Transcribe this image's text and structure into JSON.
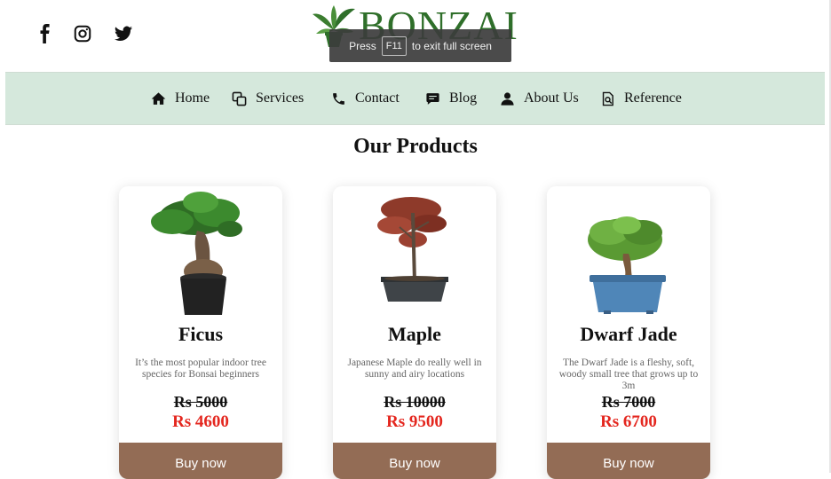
{
  "social": [
    {
      "icon": "facebook-icon"
    },
    {
      "icon": "instagram-icon"
    },
    {
      "icon": "twitter-icon"
    }
  ],
  "logo": {
    "text": "BONZAI",
    "color": "#2f6f2a"
  },
  "fullscreen_toast": {
    "prefix": "Press",
    "key": "F11",
    "suffix": "to exit full screen"
  },
  "nav": {
    "background": "#d5e8dc",
    "items": [
      {
        "label": "Home",
        "icon": "home-icon"
      },
      {
        "label": "Services",
        "icon": "services-icon"
      },
      {
        "label": "Contact",
        "icon": "phone-icon"
      },
      {
        "label": "Blog",
        "icon": "chat-icon"
      },
      {
        "label": "About Us",
        "icon": "user-icon"
      },
      {
        "label": "Reference",
        "icon": "search-document-icon"
      }
    ]
  },
  "page_title": "Our Products",
  "products": [
    {
      "name": "Ficus",
      "description": "It’s the most popular indoor tree species for Bonsai beginners",
      "old_price": "Rs 5000",
      "new_price": "Rs 4600",
      "button": "Buy now"
    },
    {
      "name": "Maple",
      "description": "Japanese Maple do really well in sunny and airy locations",
      "old_price": "Rs 10000",
      "new_price": "Rs 9500",
      "button": "Buy now"
    },
    {
      "name": "Dwarf Jade",
      "description": "The Dwarf Jade is a fleshy, soft, woody small tree that grows up to 3m",
      "old_price": "Rs 7000",
      "new_price": "Rs 6700",
      "button": "Buy now"
    }
  ],
  "colors": {
    "accent_price": "#e4271f",
    "button": "#936c55",
    "button_text": "#ffffff"
  }
}
